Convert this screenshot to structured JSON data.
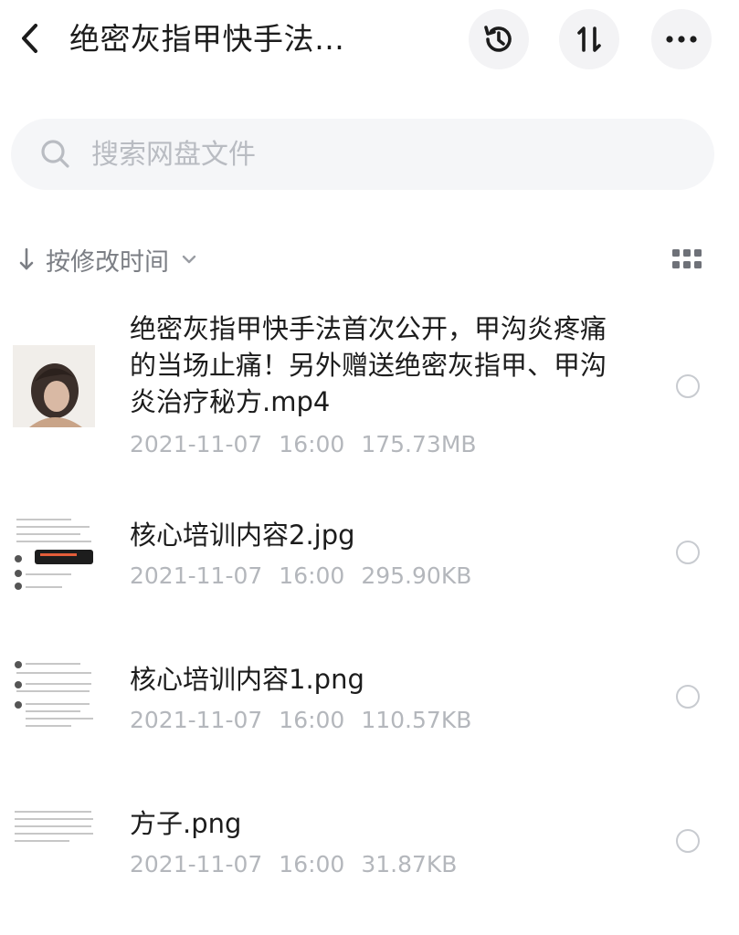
{
  "header": {
    "title": "绝密灰指甲快手法…",
    "back_icon": "chevron-left-icon",
    "history_icon": "history-icon",
    "sort_icon": "sort-arrows-icon",
    "more_icon": "more-dots-icon"
  },
  "search": {
    "placeholder": "搜索网盘文件",
    "icon": "search-icon"
  },
  "sort": {
    "label": "按修改时间",
    "direction_icon": "arrow-down-icon",
    "dropdown_icon": "chevron-down-icon",
    "view_icon": "grid-view-icon"
  },
  "files": [
    {
      "name": "绝密灰指甲快手法首次公开，甲沟炎疼痛的当场止痛！另外赠送绝密灰指甲、甲沟炎治疗秘方.mp4",
      "date": "2021-11-07",
      "time": "16:00",
      "size": "175.73MB",
      "thumb": "video-thumbnail"
    },
    {
      "name": "核心培训内容2.jpg",
      "date": "2021-11-07",
      "time": "16:00",
      "size": "295.90KB",
      "thumb": "image-thumbnail"
    },
    {
      "name": "核心培训内容1.png",
      "date": "2021-11-07",
      "time": "16:00",
      "size": "110.57KB",
      "thumb": "image-thumbnail"
    },
    {
      "name": "方子.png",
      "date": "2021-11-07",
      "time": "16:00",
      "size": "31.87KB",
      "thumb": "image-thumbnail"
    }
  ],
  "colors": {
    "text": "#1c1c1c",
    "meta": "#b4b7bc",
    "button_bg": "#f3f3f5",
    "search_bg": "#f5f6f8"
  }
}
